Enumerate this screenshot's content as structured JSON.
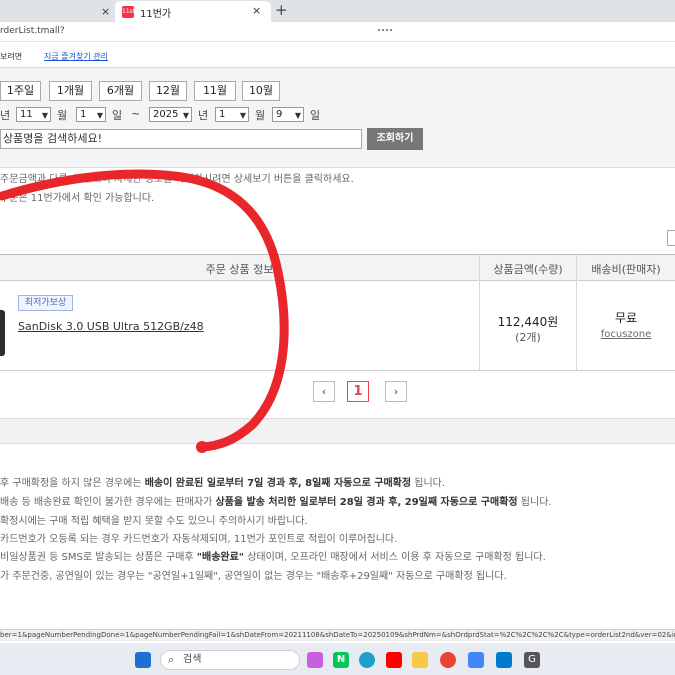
{
  "browser": {
    "tab1_close": "×",
    "tab2_title": "11번가",
    "tab2_favicon": "11st",
    "tab2_close": "×",
    "new_tab": "+",
    "url": "rderList.tmall?"
  },
  "infobar": {
    "text": "보려면",
    "link": "지금 즐겨찾기 관리"
  },
  "period_buttons": [
    "1주일",
    "1개월",
    "6개월",
    "12월",
    "11월",
    "10월"
  ],
  "date_range": {
    "from_unit_year": "년",
    "from_month": "11",
    "unit_month": "월",
    "from_day": "1",
    "unit_day": "일",
    "tilde": "~",
    "to_year": "2025",
    "unit_year": "년",
    "to_month": "1",
    "to_day": "9"
  },
  "search": {
    "placeholder": "상품명을 검색하세요!",
    "button": "조회하기"
  },
  "notices": [
    "주문금액과 다른 수 있으며 자세한 정보를 확인하시려면 상세보기 버튼을 클릭하세요.",
    "주문은 11번가에서 확인 가능합니다."
  ],
  "table": {
    "headers": [
      "주문 상품 정보",
      "상품금액(수량)",
      "배송비(판매자)"
    ],
    "row": {
      "badge": "최저가보상",
      "product_name": "SanDisk 3.0 USB Ultra 512GB/z48",
      "price": "112,440원",
      "qty": "(2개)",
      "shipping": "무료",
      "seller": "focuszone"
    }
  },
  "pagination": {
    "prev": "‹",
    "current": "1",
    "next": "›"
  },
  "info_lines": [
    {
      "pre": "후 구매확정을 하지 않은 경우에는 ",
      "bold": "배송이 완료된 일로부터 7일 경과 후, 8일째 자동으로 구매확정",
      "post": " 됩니다."
    },
    {
      "pre": "배송 등 배송완료 확인이 불가한 경우에는 판매자가 ",
      "bold": "상품을 발송 처리한 일로부터 28일 경과 후, 29일째 자동으로 구매확정",
      "post": " 됩니다."
    },
    {
      "pre": "확정시에는 구매 적립 혜택을 받지 못할 수도 있으니 주의하시기 바랍니다.",
      "bold": "",
      "post": ""
    },
    {
      "pre": "카드번호가 오등록 되는 경우 카드번호가 자동삭제되며, 11번가 포인트로 적립이 이루어집니다.",
      "bold": "",
      "post": ""
    },
    {
      "pre": "비일상품권 등 SMS로 발송되는 상품은 구매후 ",
      "bold": "\"배송완료\"",
      "post": " 상태이며, 오프라인 매장에서 서비스 이용 후 자동으로 구매확정 됩니다."
    },
    {
      "pre": "가 주문건중, 공연일이 있는 경우는 \"공연일+1일째\", 공연일이 없는 경우는 \"배송후+29일째\" 자동으로 구매확정 됩니다.",
      "bold": "",
      "post": ""
    }
  ],
  "status_url": "ber=1&pageNumberPendingDone=1&pageNumberPendingFail=1&shDateFrom=20211108&shDateTo=20250109&shPrdNm=&shOrdprdStat=%2C%2C%2C%2C&type=orderList2nd&ver=02&inDate=#",
  "taskbar": {
    "search_label": "검색",
    "icons": [
      "windows-start",
      "search",
      "widgets",
      "copilot",
      "naver",
      "edge",
      "youtube",
      "file-explorer",
      "chrome",
      "google-translate",
      "vscode",
      "google-app"
    ]
  },
  "colors": {
    "accent_red": "#e83a3a",
    "annotation_red": "#e8262b",
    "link_blue": "#1a55d6"
  }
}
